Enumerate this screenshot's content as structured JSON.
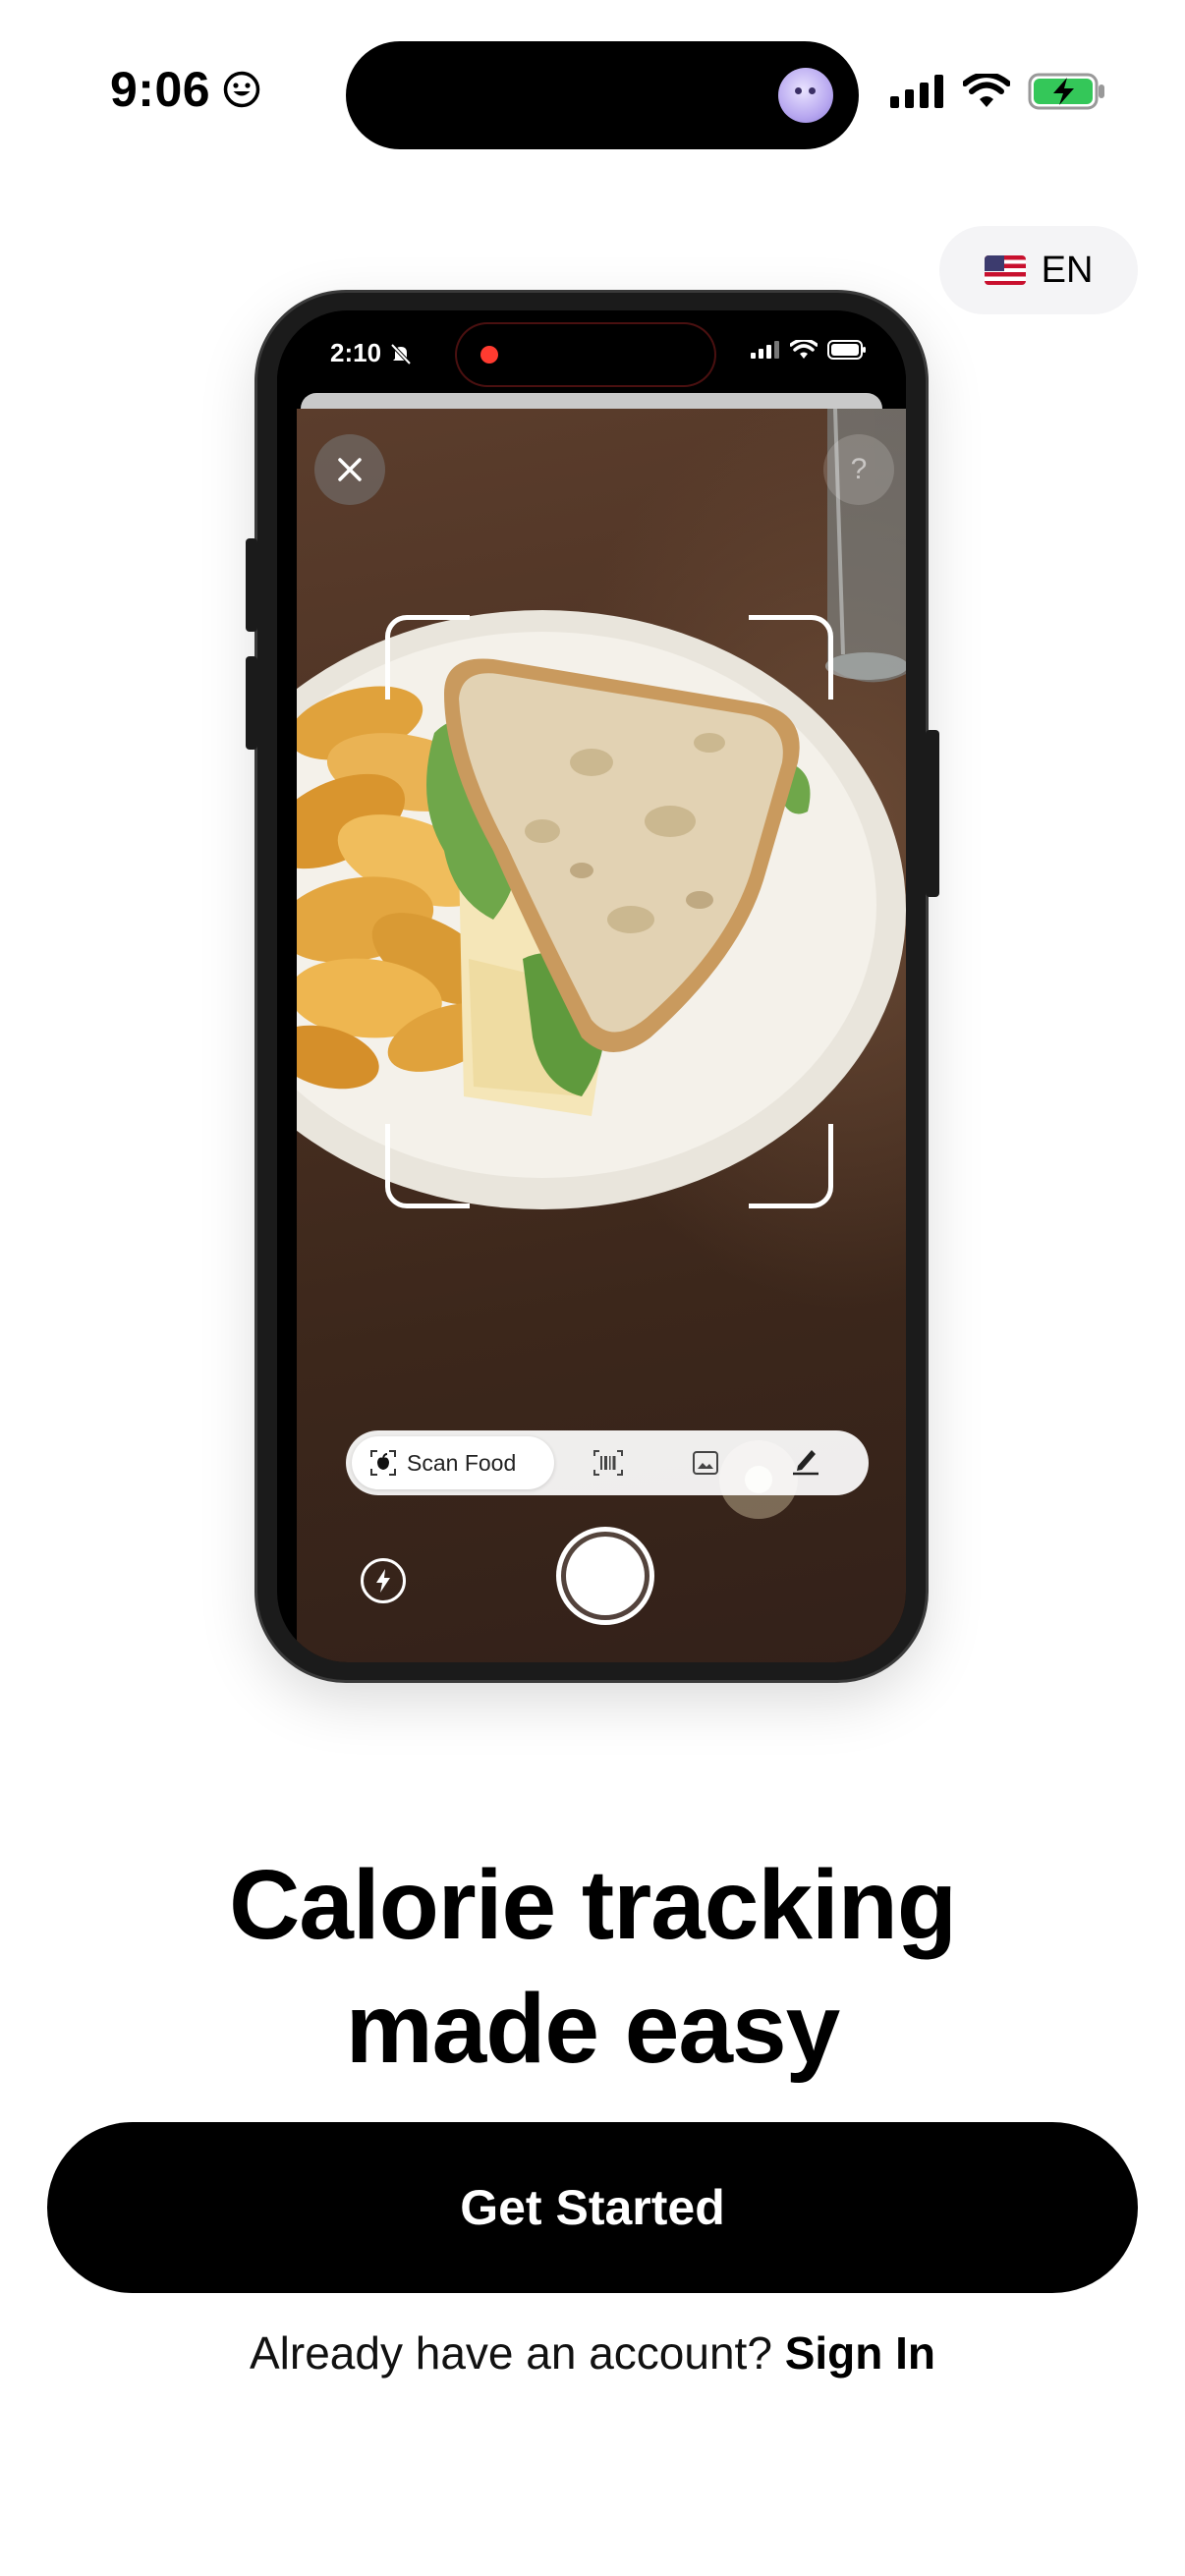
{
  "status_bar": {
    "time": "9:06",
    "smile_icon": "smiley-face-icon",
    "battery_color": "#34c759"
  },
  "language": {
    "flag": "us-flag-icon",
    "code": "EN"
  },
  "mockup": {
    "status_time": "2:10",
    "scan_mode_label": "Scan Food",
    "help_glyph": "?",
    "modes": [
      "scan-food",
      "barcode",
      "gallery",
      "manual-entry"
    ]
  },
  "headline": {
    "line1": "Calorie tracking",
    "line2": "made easy"
  },
  "cta": {
    "label": "Get Started",
    "color": "#000000"
  },
  "signin": {
    "prompt": "Already have an account?",
    "link": "Sign In"
  }
}
